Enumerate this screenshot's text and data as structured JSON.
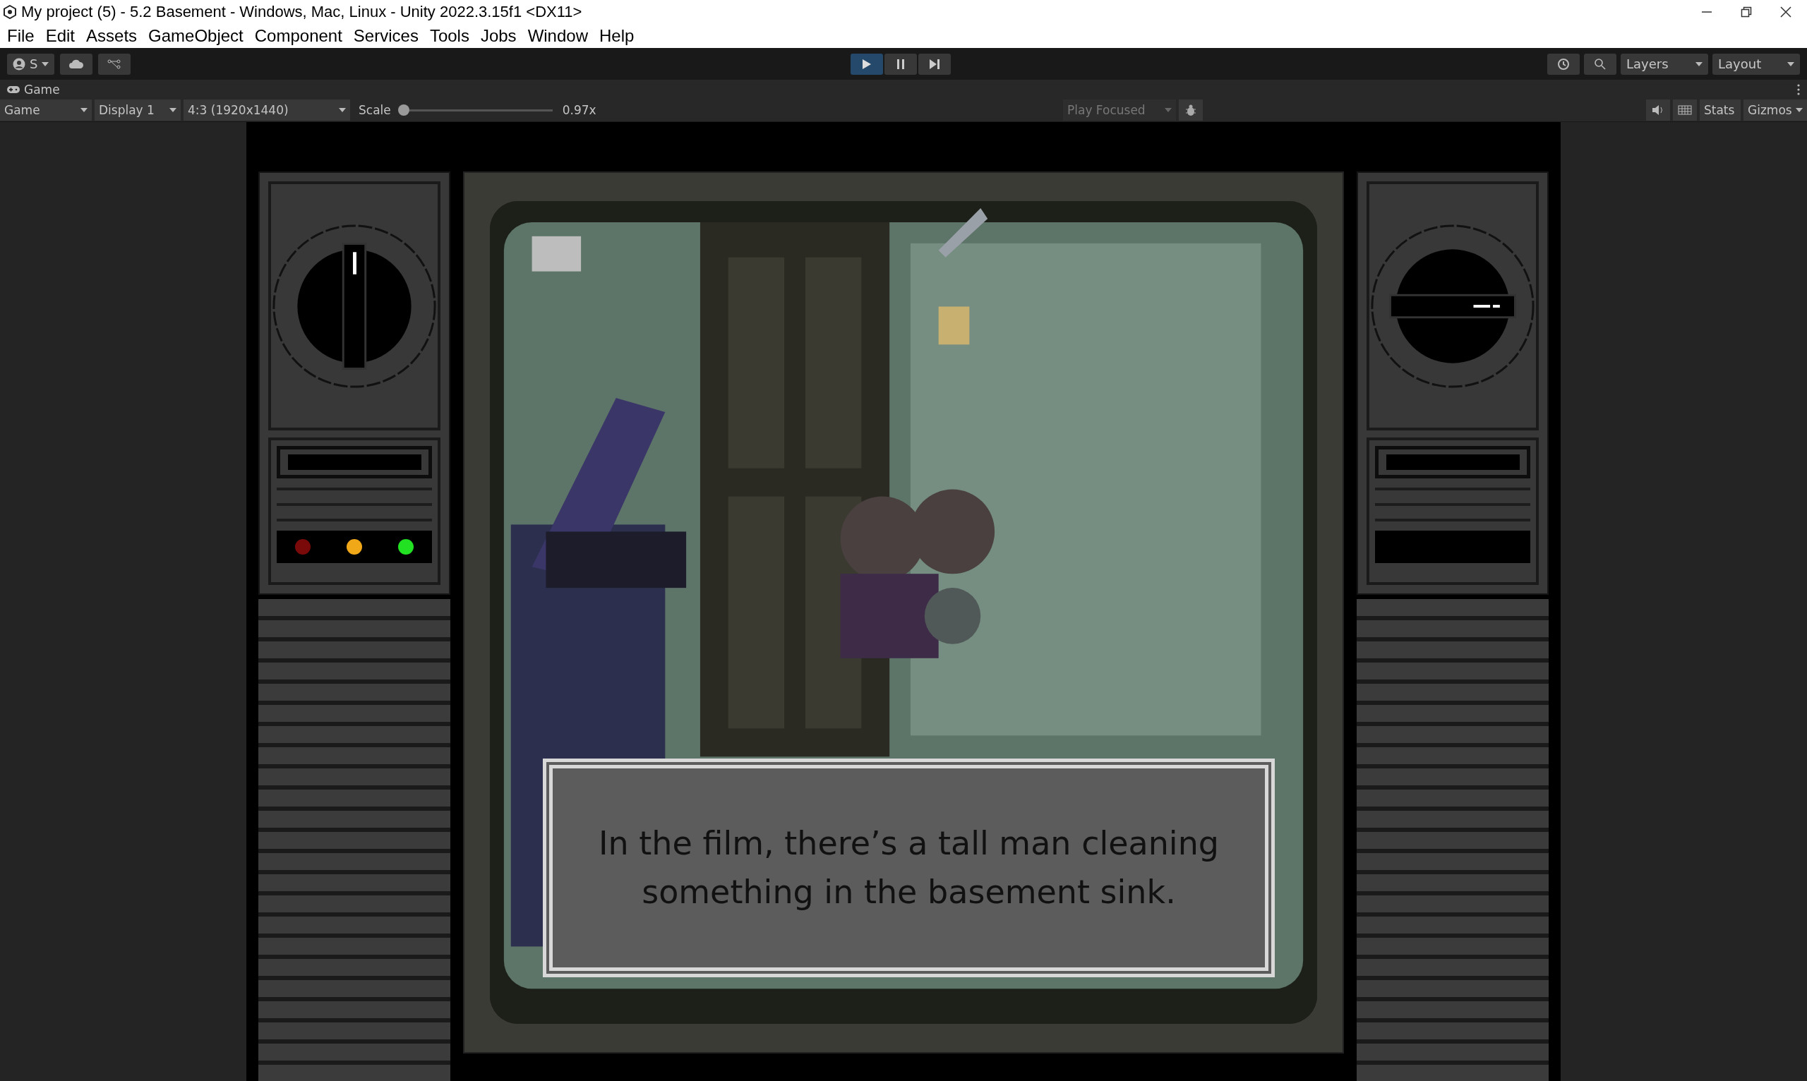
{
  "window": {
    "title": "My project (5) - 5.2 Basement - Windows, Mac, Linux - Unity 2022.3.15f1 <DX11>"
  },
  "menu": [
    "File",
    "Edit",
    "Assets",
    "GameObject",
    "Component",
    "Services",
    "Tools",
    "Jobs",
    "Window",
    "Help"
  ],
  "toolbar": {
    "account": "S",
    "play_controls": [
      {
        "kind": "play",
        "selected": true
      },
      {
        "kind": "pause",
        "selected": false
      },
      {
        "kind": "step",
        "selected": false
      }
    ],
    "layers": "Layers",
    "layout": "Layout"
  },
  "game_panel": {
    "tab": "Game",
    "view_dropdown": "Game",
    "display": "Display 1",
    "aspect": "4:3 (1920x1440)",
    "scale_label": "Scale",
    "scale": {
      "level": 0.02
    },
    "scale_reading": "0.97x",
    "play_mode": "Play Focused",
    "stats": "Stats",
    "gizmos": "Gizmos"
  },
  "game": {
    "dialogue": "In the film, there’s a tall man cleaning something in the basement sink.",
    "lights": [
      {
        "color": "#7a0a0a"
      },
      {
        "color": "#f0a818"
      },
      {
        "color": "#22e022"
      }
    ]
  }
}
